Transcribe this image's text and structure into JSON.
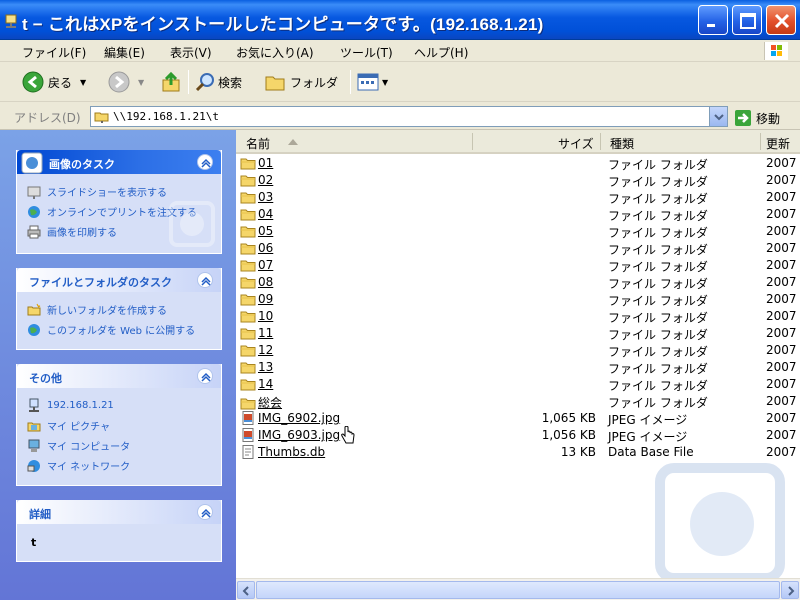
{
  "window": {
    "title": "t − これはXPをインストールしたコンピュータです。(192.168.1.21)"
  },
  "menu": [
    "ファイル(F)",
    "編集(E)",
    "表示(V)",
    "お気に入り(A)",
    "ツール(T)",
    "ヘルプ(H)"
  ],
  "toolbar": {
    "back_label": "戻る",
    "search_label": "検索",
    "folders_label": "フォルダ"
  },
  "address": {
    "label": "アドレス(D)",
    "value": "\\\\192.168.1.21\\t",
    "go_label": "移動"
  },
  "sidebar": {
    "picture_tasks": {
      "title": "画像のタスク",
      "items": [
        "スライドショーを表示する",
        "オンラインでプリントを注文する",
        "画像を印刷する"
      ]
    },
    "file_tasks": {
      "title": "ファイルとフォルダのタスク",
      "items": [
        "新しいフォルダを作成する",
        "このフォルダを Web に公開する"
      ]
    },
    "other_places": {
      "title": "その他",
      "items": [
        "192.168.1.21",
        "マイ ピクチャ",
        "マイ コンピュータ",
        "マイ ネットワーク"
      ]
    },
    "details": {
      "title": "詳細",
      "value": "t"
    }
  },
  "filelist": {
    "columns": {
      "name": "名前",
      "size": "サイズ",
      "type": "種類",
      "date": "更新"
    },
    "rows": [
      {
        "name": "01",
        "size": "",
        "type": "ファイル フォルダ",
        "date": "2007",
        "icon": "folder-icon"
      },
      {
        "name": "02",
        "size": "",
        "type": "ファイル フォルダ",
        "date": "2007",
        "icon": "folder-icon"
      },
      {
        "name": "03",
        "size": "",
        "type": "ファイル フォルダ",
        "date": "2007",
        "icon": "folder-icon"
      },
      {
        "name": "04",
        "size": "",
        "type": "ファイル フォルダ",
        "date": "2007",
        "icon": "folder-icon"
      },
      {
        "name": "05",
        "size": "",
        "type": "ファイル フォルダ",
        "date": "2007",
        "icon": "folder-icon"
      },
      {
        "name": "06",
        "size": "",
        "type": "ファイル フォルダ",
        "date": "2007",
        "icon": "folder-icon"
      },
      {
        "name": "07",
        "size": "",
        "type": "ファイル フォルダ",
        "date": "2007",
        "icon": "folder-icon"
      },
      {
        "name": "08",
        "size": "",
        "type": "ファイル フォルダ",
        "date": "2007",
        "icon": "folder-icon"
      },
      {
        "name": "09",
        "size": "",
        "type": "ファイル フォルダ",
        "date": "2007",
        "icon": "folder-icon"
      },
      {
        "name": "10",
        "size": "",
        "type": "ファイル フォルダ",
        "date": "2007",
        "icon": "folder-icon"
      },
      {
        "name": "11",
        "size": "",
        "type": "ファイル フォルダ",
        "date": "2007",
        "icon": "folder-icon"
      },
      {
        "name": "12",
        "size": "",
        "type": "ファイル フォルダ",
        "date": "2007",
        "icon": "folder-icon"
      },
      {
        "name": "13",
        "size": "",
        "type": "ファイル フォルダ",
        "date": "2007",
        "icon": "folder-icon"
      },
      {
        "name": "14",
        "size": "",
        "type": "ファイル フォルダ",
        "date": "2007",
        "icon": "folder-icon"
      },
      {
        "name": "総会",
        "size": "",
        "type": "ファイル フォルダ",
        "date": "2007",
        "icon": "folder-icon"
      },
      {
        "name": "IMG_6902.jpg",
        "size": "1,065 KB",
        "type": "JPEG イメージ",
        "date": "2007",
        "icon": "jpeg-file-icon"
      },
      {
        "name": "IMG_6903.jpg",
        "size": "1,056 KB",
        "type": "JPEG イメージ",
        "date": "2007",
        "icon": "jpeg-file-icon"
      },
      {
        "name": "Thumbs.db",
        "size": "13 KB",
        "type": "Data Base File",
        "date": "2007",
        "icon": "db-file-icon"
      }
    ]
  }
}
